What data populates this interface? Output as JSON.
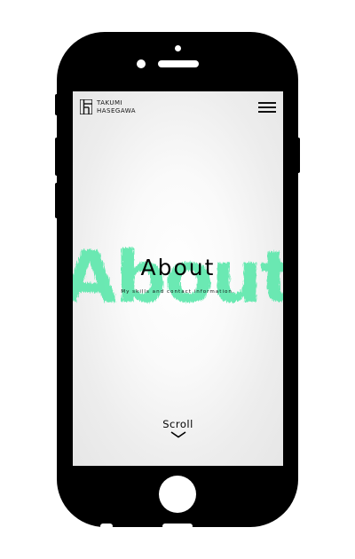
{
  "header": {
    "logo_line1": "TAKUMI",
    "logo_line2": "HASEGAWA",
    "menu_icon": "hamburger-menu-icon"
  },
  "hero": {
    "background_word": "About",
    "title": "About",
    "subtitle": "My skills and contact information.",
    "accent_color": "#5fe8ad"
  },
  "scroll": {
    "label": "Scroll",
    "icon": "chevron-down-icon"
  },
  "device": {
    "body_color": "#000000",
    "screen_color": "#f4f4f4"
  }
}
